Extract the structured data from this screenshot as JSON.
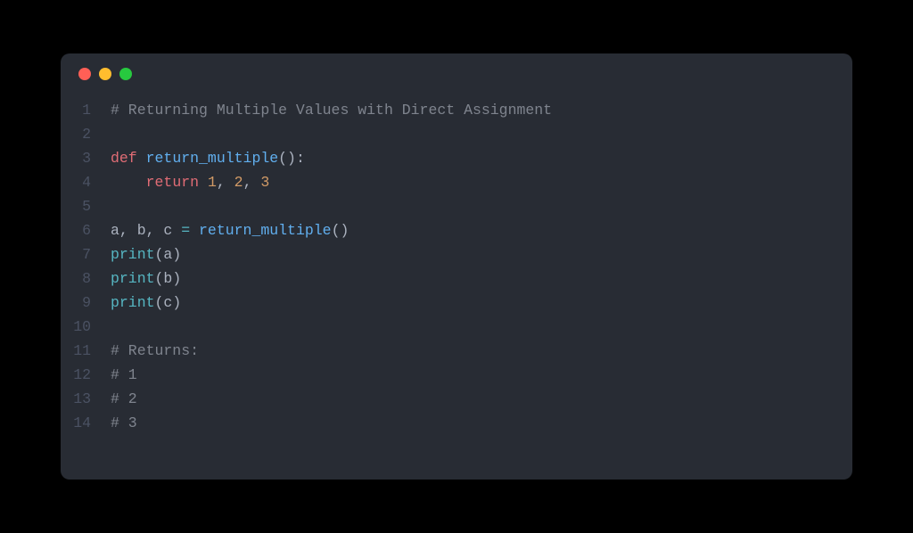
{
  "window": {
    "traffic_lights": [
      "close",
      "minimize",
      "zoom"
    ]
  },
  "code": {
    "language": "python",
    "lines": [
      {
        "n": "1",
        "tokens": [
          {
            "t": "# Returning Multiple Values with Direct Assignment",
            "c": "comment"
          }
        ]
      },
      {
        "n": "2",
        "tokens": []
      },
      {
        "n": "3",
        "tokens": [
          {
            "t": "def",
            "c": "def"
          },
          {
            "t": " ",
            "c": "ident"
          },
          {
            "t": "return_multiple",
            "c": "func"
          },
          {
            "t": "():",
            "c": "paren"
          }
        ]
      },
      {
        "n": "4",
        "tokens": [
          {
            "t": "    ",
            "c": "ident"
          },
          {
            "t": "return",
            "c": "return"
          },
          {
            "t": " ",
            "c": "ident"
          },
          {
            "t": "1",
            "c": "number"
          },
          {
            "t": ", ",
            "c": "punct"
          },
          {
            "t": "2",
            "c": "number"
          },
          {
            "t": ", ",
            "c": "punct"
          },
          {
            "t": "3",
            "c": "number"
          }
        ]
      },
      {
        "n": "5",
        "tokens": []
      },
      {
        "n": "6",
        "tokens": [
          {
            "t": "a, b, c ",
            "c": "ident"
          },
          {
            "t": "=",
            "c": "op"
          },
          {
            "t": " ",
            "c": "ident"
          },
          {
            "t": "return_multiple",
            "c": "func"
          },
          {
            "t": "()",
            "c": "paren"
          }
        ]
      },
      {
        "n": "7",
        "tokens": [
          {
            "t": "print",
            "c": "builtin"
          },
          {
            "t": "(a)",
            "c": "paren"
          }
        ]
      },
      {
        "n": "8",
        "tokens": [
          {
            "t": "print",
            "c": "builtin"
          },
          {
            "t": "(b)",
            "c": "paren"
          }
        ]
      },
      {
        "n": "9",
        "tokens": [
          {
            "t": "print",
            "c": "builtin"
          },
          {
            "t": "(c)",
            "c": "paren"
          }
        ]
      },
      {
        "n": "10",
        "tokens": []
      },
      {
        "n": "11",
        "tokens": [
          {
            "t": "# Returns:",
            "c": "comment"
          }
        ]
      },
      {
        "n": "12",
        "tokens": [
          {
            "t": "# 1",
            "c": "comment"
          }
        ]
      },
      {
        "n": "13",
        "tokens": [
          {
            "t": "# 2",
            "c": "comment"
          }
        ]
      },
      {
        "n": "14",
        "tokens": [
          {
            "t": "# 3",
            "c": "comment"
          }
        ]
      }
    ]
  }
}
